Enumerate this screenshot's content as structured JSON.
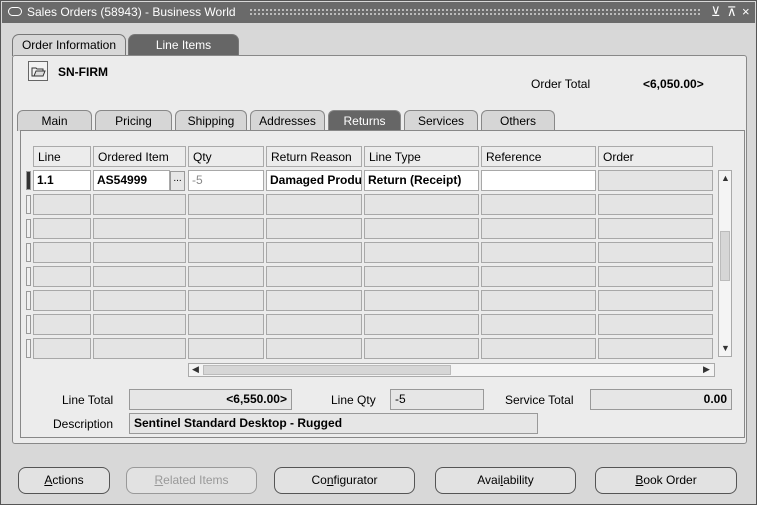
{
  "window": {
    "title": "Sales Orders (58943) - Business World",
    "minimize_label": "⊻",
    "maximize_label": "⊼",
    "close_label": "×"
  },
  "tabs": [
    {
      "label": "Order Information",
      "active": false
    },
    {
      "label": "Line Items",
      "active": true
    }
  ],
  "header": {
    "customer": "SN-FIRM",
    "order_total_label": "Order Total",
    "order_total_value": "<6,050.00>"
  },
  "subtabs": [
    {
      "label": "Main"
    },
    {
      "label": "Pricing"
    },
    {
      "label": "Shipping"
    },
    {
      "label": "Addresses"
    },
    {
      "label": "Returns",
      "active": true
    },
    {
      "label": "Services"
    },
    {
      "label": "Others"
    }
  ],
  "table": {
    "columns": [
      "Line",
      "Ordered Item",
      "Qty",
      "Return Reason",
      "Line Type",
      "Reference",
      "Order"
    ],
    "rows": [
      [
        "1.1",
        "AS54999",
        "-5",
        "Damaged Product",
        "Return (Receipt)",
        "",
        ""
      ]
    ],
    "lov_label": "..."
  },
  "summary": {
    "line_total_label": "Line Total",
    "line_total_value": "<6,550.00>",
    "line_qty_label": "Line Qty",
    "line_qty_value": "-5",
    "service_total_label": "Service Total",
    "service_total_value": "0.00",
    "description_label": "Description",
    "description_value": "Sentinel Standard Desktop - Rugged"
  },
  "buttons": {
    "actions": {
      "mnemonic": "A",
      "rest": "ctions"
    },
    "related_items": {
      "mnemonic": "R",
      "rest": "elated Items"
    },
    "configurator": {
      "pre": "Co",
      "mnemonic": "n",
      "rest": "figurator"
    },
    "availability": {
      "pre": "Avai",
      "mnemonic": "l",
      "rest": "ability"
    },
    "book_order": {
      "mnemonic": "B",
      "rest": "ook Order"
    }
  }
}
